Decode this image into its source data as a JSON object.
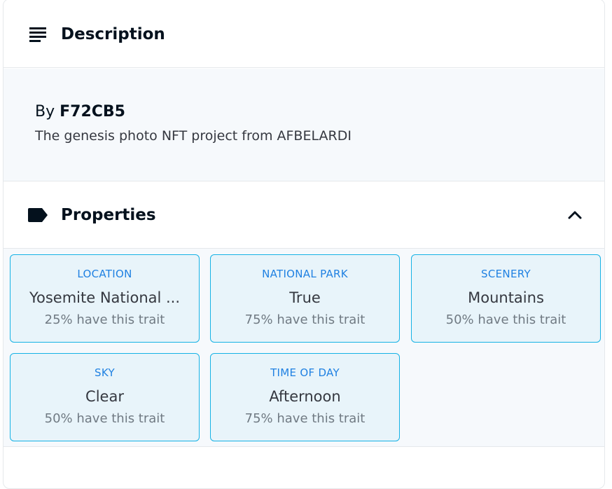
{
  "description": {
    "title": "Description",
    "icon": "subject-lines-icon",
    "by_prefix": "By",
    "creator": "F72CB5",
    "text": "The genesis photo NFT project from AFBELARDI"
  },
  "properties": {
    "title": "Properties",
    "icon": "label-tag-icon",
    "collapse_icon": "chevron-up-icon",
    "traits": [
      {
        "type": "LOCATION",
        "value": "Yosemite National ...",
        "rarity": "25% have this trait"
      },
      {
        "type": "NATIONAL PARK",
        "value": "True",
        "rarity": "75% have this trait"
      },
      {
        "type": "SCENERY",
        "value": "Mountains",
        "rarity": "50% have this trait"
      },
      {
        "type": "SKY",
        "value": "Clear",
        "rarity": "50% have this trait"
      },
      {
        "type": "TIME OF DAY",
        "value": "Afternoon",
        "rarity": "75% have this trait"
      }
    ]
  },
  "colors": {
    "accent": "#2081e2",
    "trait_border": "#15b2e5",
    "text_primary": "#04111d",
    "text_secondary": "#707a83",
    "panel_bg": "#f6f9fc"
  }
}
